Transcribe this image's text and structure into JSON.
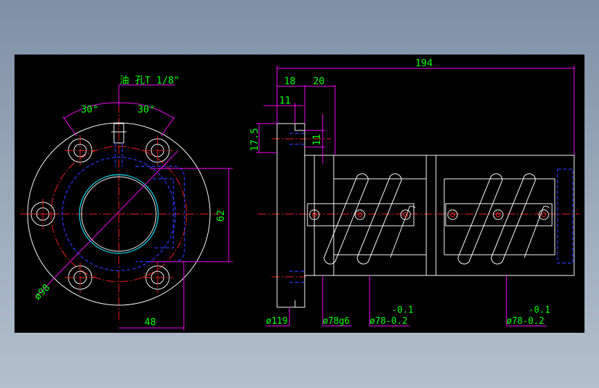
{
  "colors": {
    "background": "#000000",
    "outline": "#ffffff",
    "dimension_line": "#ff00ff",
    "dimension_text": "#00ff00",
    "center_line": "#ff2020",
    "hidden_line": "#2a3cff",
    "highlight": "#00e5ff"
  },
  "front_view": {
    "oil_hole_label": "油 孔T 1/8\"",
    "angle_left": "30°",
    "angle_right": "30°",
    "diameter_98": "ø98",
    "dim_62": "62",
    "dim_48": "48"
  },
  "side_view": {
    "dim_194": "194",
    "dim_18": "18",
    "dim_20": "20",
    "dim_11_top": "11",
    "dim_17_5": "17.5",
    "dim_11_vert": "11",
    "dia_119": "ø119",
    "dia_78g6": "ø78g6",
    "dia_78_a": "ø78-0.2",
    "tol_a": "-0.1",
    "dia_78_b": "ø78-0.2",
    "tol_b": "-0.1"
  }
}
